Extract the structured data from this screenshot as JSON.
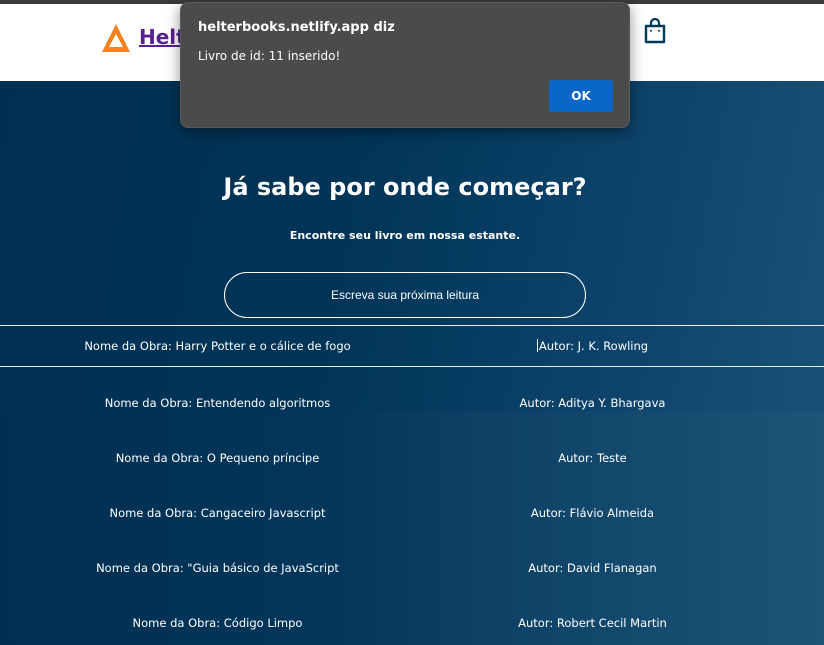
{
  "header": {
    "brand": "Helte",
    "colors": {
      "accent": "#f58220",
      "brand_link": "#5a1f8e",
      "icon": "#003b5c"
    }
  },
  "hero": {
    "title": "Já sabe por onde começar?",
    "subtitle": "Encontre seu livro em nossa estante.",
    "search_placeholder": "Escreva sua próxima leitura"
  },
  "books": [
    {
      "name": "Nome da Obra: Harry Potter e o cálice de fogo",
      "author": "Autor: J. K. Rowling"
    },
    {
      "name": "Nome da Obra: Entendendo algoritmos",
      "author": "Autor: Aditya Y. Bhargava"
    },
    {
      "name": "Nome da Obra: O Pequeno príncipe",
      "author": "Autor: Teste"
    },
    {
      "name": "Nome da Obra: Cangaceiro Javascript",
      "author": "Autor: Flávio Almeida"
    },
    {
      "name": "Nome da Obra: \"Guia básico de JavaScript",
      "author": "Autor: David Flanagan"
    },
    {
      "name": "Nome da Obra: Código Limpo",
      "author": "Autor: Robert Cecil Martin"
    }
  ],
  "dialog": {
    "site": "helterbooks.netlify.app diz",
    "message": "Livro de id: 11 inserido!",
    "ok_label": "OK",
    "colors": {
      "background": "#4b4b4b",
      "button": "#0a66c8"
    }
  }
}
